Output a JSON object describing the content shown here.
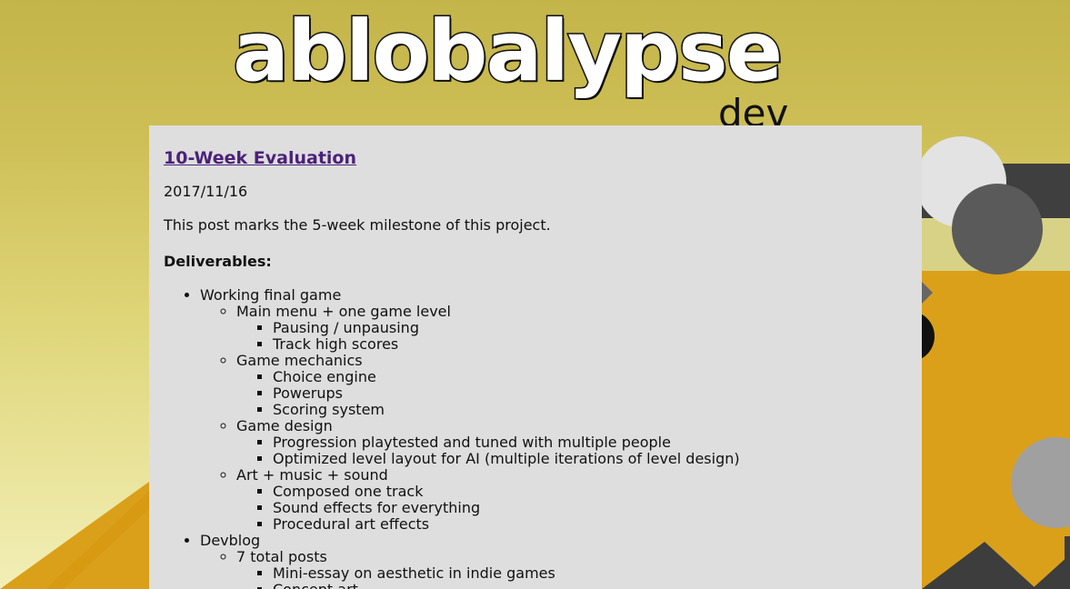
{
  "header": {
    "logo_text": "ablobalypse",
    "logo_subtitle": "dev blog"
  },
  "post": {
    "title": "10-Week Evaluation",
    "date": "2017/11/16",
    "intro": "This post marks the 5-week milestone of this project.",
    "deliverables_heading": "Deliverables:",
    "items": [
      {
        "label": "Working final game",
        "children": [
          {
            "label": "Main menu + one game level",
            "children": [
              "Pausing / unpausing",
              "Track high scores"
            ]
          },
          {
            "label": "Game mechanics",
            "children": [
              "Choice engine",
              "Powerups",
              "Scoring system"
            ]
          },
          {
            "label": "Game design",
            "children": [
              "Progression playtested and tuned with multiple people",
              "Optimized level layout for AI (multiple iterations of level design)"
            ]
          },
          {
            "label": "Art + music + sound",
            "children": [
              "Composed one track",
              "Sound effects for everything",
              "Procedural art effects"
            ]
          }
        ]
      },
      {
        "label": "Devblog",
        "children": [
          {
            "label": "7 total posts",
            "children": [
              "Mini-essay on aesthetic in indie games",
              "Concept art"
            ]
          }
        ]
      }
    ]
  },
  "colors": {
    "background_top": "#c4b54a",
    "background_bottom": "#f2efb7",
    "orange_shape": "#dba01a",
    "content_panel": "#dedede",
    "link": "#4b2279"
  }
}
